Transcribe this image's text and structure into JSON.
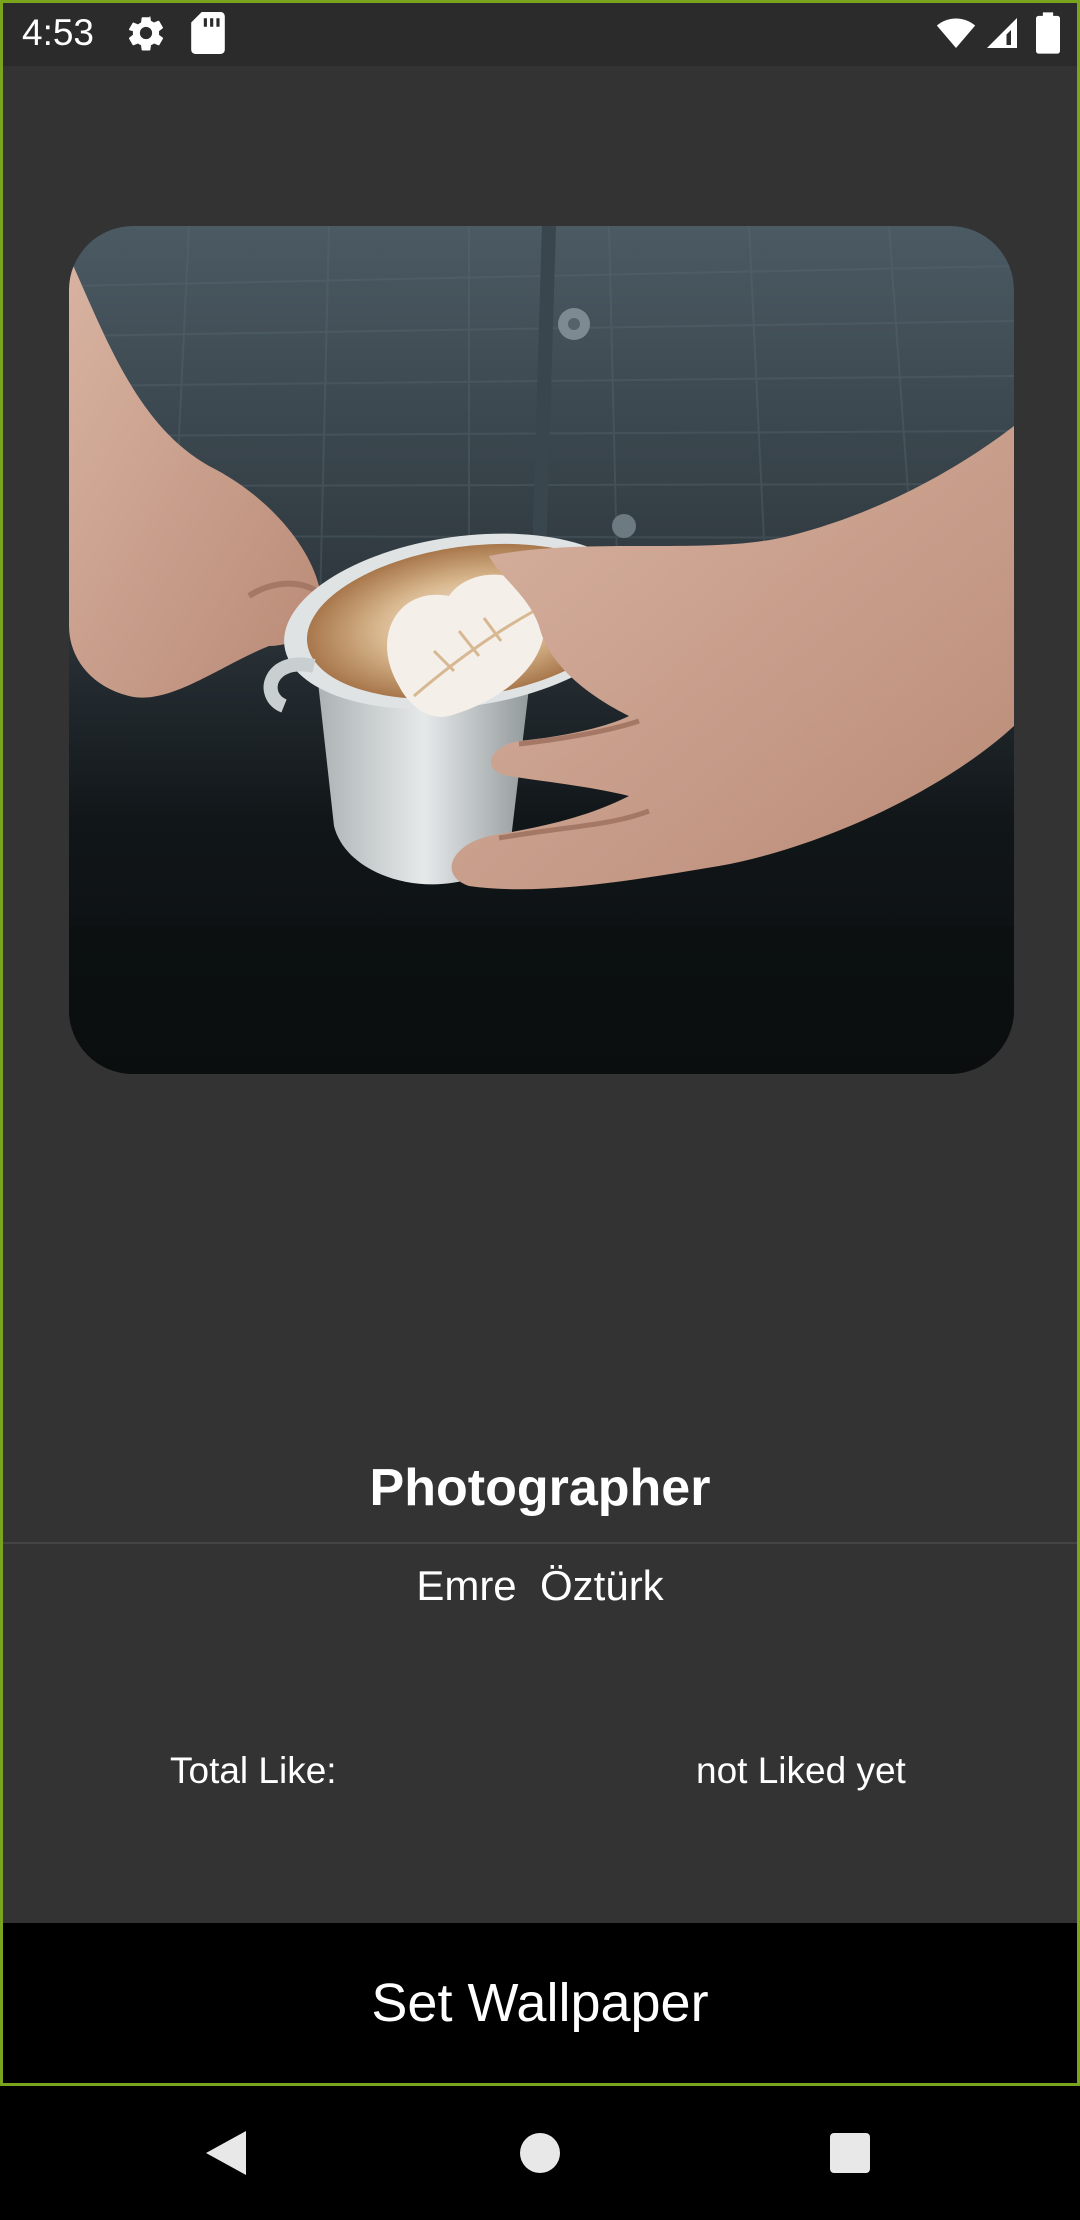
{
  "status_bar": {
    "time": "4:53",
    "icons": [
      "settings-icon",
      "sd-card-icon",
      "wifi-icon",
      "signal-icon",
      "battery-icon"
    ]
  },
  "colors": {
    "background": "#333333",
    "status_bar": "#2b2b2b",
    "frame_outline": "#7aa41e",
    "button_background": "#000000",
    "text": "#ffffff"
  },
  "photo": {
    "subject": "hands holding a latte art coffee cup"
  },
  "details": {
    "photographer_title": "Photographer",
    "photographer_name": "Emre  Öztürk",
    "total_like_label": "Total Like:",
    "total_like_value": "not Liked yet"
  },
  "actions": {
    "set_wallpaper_label": "Set Wallpaper"
  },
  "nav_bar": {
    "buttons": [
      "back-icon",
      "home-icon",
      "recents-icon"
    ]
  }
}
